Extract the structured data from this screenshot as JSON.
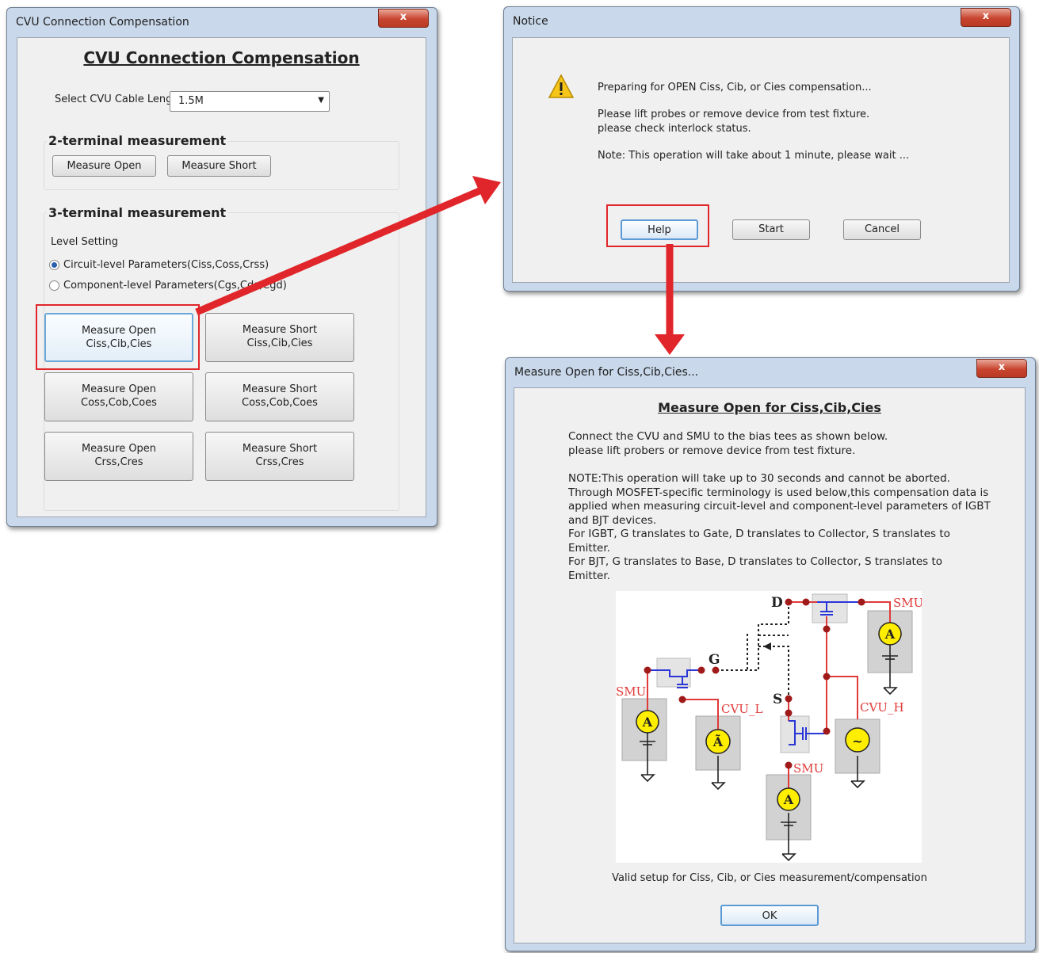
{
  "comp_window": {
    "title": "CVU Connection Compensation",
    "close": "x",
    "heading": "CVU Connection Compensation",
    "cable_label": "Select CVU Cable Length",
    "cable_value": "1.5M",
    "two_terminal": {
      "header": "2-terminal measurement",
      "open_label": "Measure Open",
      "short_label": "Measure Short"
    },
    "three_terminal": {
      "header": "3-terminal measurement",
      "level_label": "Level Setting",
      "option1": "Circuit-level Parameters(Ciss,Coss,Crss)",
      "option2": "Component-level Parameters(Cgs,Cds,Cgd)",
      "selected_option": 1
    },
    "buttons": [
      {
        "line1": "Measure Open",
        "line2": "Ciss,Cib,Cies"
      },
      {
        "line1": "Measure Short",
        "line2": "Ciss,Cib,Cies"
      },
      {
        "line1": "Measure Open",
        "line2": "Coss,Cob,Coes"
      },
      {
        "line1": "Measure Short",
        "line2": "Coss,Cob,Coes"
      },
      {
        "line1": "Measure Open",
        "line2": "Crss,Cres"
      },
      {
        "line1": "Measure Short",
        "line2": "Crss,Cres"
      }
    ]
  },
  "notice_window": {
    "title": "Notice",
    "close": "x",
    "line1": "Preparing for OPEN Ciss, Cib, or Cies compensation...",
    "line2": "Please lift probes or remove device from test fixture.",
    "line3": "please check interlock status.",
    "line4": "Note: This operation will take about 1 minute, please wait ...",
    "help_label": "Help",
    "start_label": "Start",
    "cancel_label": "Cancel"
  },
  "measure_window": {
    "title": "Measure Open for Ciss,Cib,Cies...",
    "close": "x",
    "heading": "Measure Open for Ciss,Cib,Cies",
    "para1": [
      "Connect the CVU and SMU to the bias tees as shown below.",
      "please lift probers or remove device from test fixture."
    ],
    "para2": [
      "NOTE:This operation will take up to 30 seconds and cannot be aborted.",
      "Through MOSFET-specific terminology is used below,this compensation data is",
      "applied when measuring circuit-level and component-level parameters of IGBT",
      "and BJT devices.",
      "For IGBT, G translates to Gate, D translates to Collector, S translates to",
      "Emitter.",
      "For BJT, G translates to Base, D translates to Collector, S translates to",
      "Emitter."
    ],
    "diagram": {
      "d": "D",
      "g": "G",
      "s": "S",
      "smu": "SMU",
      "cvu_l": "CVU_L",
      "cvu_h": "CVU_H",
      "ammeter": "A",
      "ac_meter": "Ã",
      "ac_source": "~"
    },
    "caption": "Valid setup for Ciss, Cib, or Cies measurement/compensation",
    "ok_label": "OK"
  },
  "colors": {
    "highlight": "#e0262a",
    "arrow": "#e0262a",
    "wire_red": "#e03a3a",
    "wire_blue": "#2b36d6",
    "node": "#a01a1a"
  }
}
